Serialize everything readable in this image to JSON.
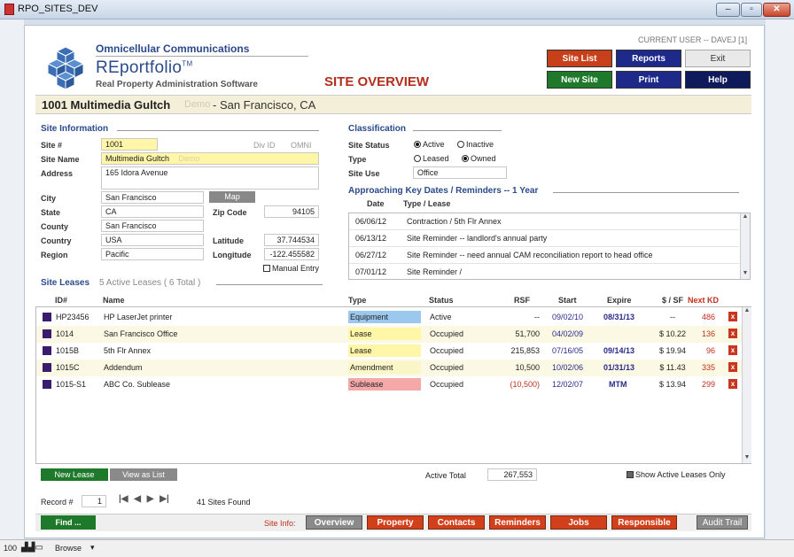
{
  "window": {
    "title": "RPO_SITES_DEV"
  },
  "header": {
    "company": "Omnicellular Communications",
    "product": "REportfolio",
    "trademark": "TM",
    "tagline": "Real Property Administration Software",
    "current_user": "CURRENT USER -- DAVEJ [1]",
    "page_title": "SITE OVERVIEW"
  },
  "nav": {
    "site_list": "Site List",
    "reports": "Reports",
    "exit": "Exit",
    "new_site": "New Site",
    "print": "Print",
    "help": "Help"
  },
  "site_banner": {
    "number_name": "1001 Multimedia Gultch",
    "demo": "Demo",
    "city": "- San Francisco, CA"
  },
  "site_info": {
    "heading": "Site Information",
    "site_no_label": "Site #",
    "site_no": "1001",
    "div_id_label": "Div ID",
    "div_id": "OMNI",
    "site_name_label": "Site Name",
    "site_name": "Multimedia Gultch",
    "site_name_tag": "Demo",
    "address_label": "Address",
    "address": "165 Idora Avenue",
    "city_label": "City",
    "city": "San Francisco",
    "map_btn": "Map",
    "state_label": "State",
    "state": "CA",
    "zip_label": "Zip Code",
    "zip": "94105",
    "county_label": "County",
    "county": "San Francisco",
    "country_label": "Country",
    "country": "USA",
    "latitude_label": "Latitude",
    "latitude": "37.744534",
    "region_label": "Region",
    "region": "Pacific",
    "longitude_label": "Longitude",
    "longitude": "-122.455582",
    "manual_entry": "Manual Entry"
  },
  "classification": {
    "heading": "Classification",
    "status_label": "Site Status",
    "active": "Active",
    "inactive": "Inactive",
    "type_label": "Type",
    "leased": "Leased",
    "owned": "Owned",
    "use_label": "Site Use",
    "use": "Office"
  },
  "reminders": {
    "heading": "Approaching Key Dates / Reminders -- 1 Year",
    "col_date": "Date",
    "col_type": "Type / Lease",
    "rows": [
      {
        "date": "06/06/12",
        "text": "Contraction / 5th Flr Annex"
      },
      {
        "date": "06/13/12",
        "text": "Site Reminder -- landlord's annual party"
      },
      {
        "date": "06/27/12",
        "text": "Site Reminder -- need annual CAM reconciliation report to head office"
      },
      {
        "date": "07/01/12",
        "text": "Site Reminder /"
      }
    ]
  },
  "leases": {
    "heading": "Site Leases",
    "count": "5 Active Leases ( 6 Total )",
    "headers": {
      "id": "ID#",
      "name": "Name",
      "type": "Type",
      "status": "Status",
      "rsf": "RSF",
      "start": "Start",
      "expire": "Expire",
      "cost": "$ / SF",
      "next_kd": "Next KD"
    },
    "rows": [
      {
        "id": "HP23456",
        "name": "HP LaserJet printer",
        "type": "Equipment",
        "type_color": "#9cc8ee",
        "status": "Active",
        "rsf": "--",
        "start": "09/02/10",
        "expire": "08/31/13",
        "cost": "--",
        "next_kd": "486"
      },
      {
        "id": "1014",
        "name": "San Francisco Office",
        "type": "Lease",
        "type_color": "#fff6a8",
        "status": "Occupied",
        "rsf": "51,700",
        "start": "04/02/09",
        "expire": "",
        "cost": "$ 10.22",
        "next_kd": "136"
      },
      {
        "id": "1015B",
        "name": "5th Flr Annex",
        "type": "Lease",
        "type_color": "#fff6a8",
        "status": "Occupied",
        "rsf": "215,853",
        "start": "07/16/05",
        "expire": "09/14/13",
        "cost": "$ 19.94",
        "next_kd": "96"
      },
      {
        "id": "1015C",
        "name": "Addendum",
        "type": "Amendment",
        "type_color": "#fbf6c8",
        "status": "Occupied",
        "rsf": "10,500",
        "start": "10/02/06",
        "expire": "01/31/13",
        "cost": "$ 11.43",
        "next_kd": "335"
      },
      {
        "id": "1015-S1",
        "name": "ABC Co. Sublease",
        "type": "Sublease",
        "type_color": "#f4a8a8",
        "status": "Occupied",
        "rsf": "(10,500)",
        "start": "12/02/07",
        "expire": "MTM",
        "cost": "$ 13.94",
        "next_kd": "299"
      }
    ],
    "delete_glyph": "x",
    "new_lease": "New Lease",
    "view_as_list": "View as List",
    "active_total_label": "Active Total",
    "active_total": "267,553",
    "show_active_only": "Show Active Leases Only"
  },
  "record_nav": {
    "label": "Record #",
    "value": "1",
    "found": "41 Sites Found"
  },
  "bottom": {
    "find": "Find ...",
    "site_info_label": "Site Info:",
    "tabs": [
      "Overview",
      "Property",
      "Contacts",
      "Reminders",
      "Jobs",
      "Responsible"
    ],
    "audit_trail": "Audit Trail"
  },
  "statusbar": {
    "zoom": "100",
    "mode": "Browse"
  },
  "colors": {
    "navy": "#2a4a8c",
    "red_accent": "#b52d1c",
    "site_list_btn": "#c8401a",
    "reports_btn": "#1e2a8a",
    "new_site_btn": "#1e7a2a",
    "orange_tab": "#d1401a"
  }
}
